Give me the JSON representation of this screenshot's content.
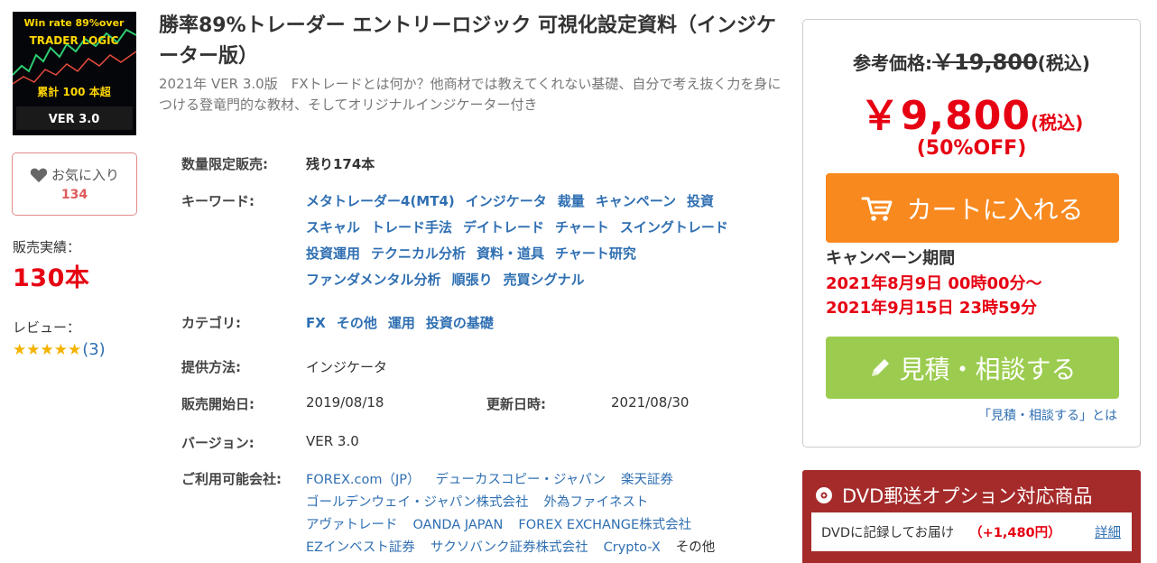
{
  "product": {
    "thumbnail_alt": "Win rate 89% over TRADER LOGIC",
    "thumb_text_1": "Win rate 89%over",
    "thumb_text_2": "TRADER LOGIC",
    "thumb_text_3": "累計 100 本超",
    "thumb_text_4": "VER 3.0",
    "title": "勝率89%トレーダー エントリーロジック 可視化設定資料（インジケーター版）",
    "description": "2021年 VER 3.0版　FXトレードとは何か？他商材では教えてくれない基礎、自分で考え抜く力を身につける登竜門的な教材、そしてオリジナルインジケーター付き"
  },
  "favorite": {
    "label": "お気に入り",
    "count": "134"
  },
  "sales": {
    "label": "販売実績：",
    "value": "130本"
  },
  "review": {
    "label": "レビュー：",
    "stars": "★★★★★",
    "count": "(3)"
  },
  "specs": {
    "limited_label": "数量限定販売:",
    "limited_value": "残り174本",
    "keyword_label": "キーワード:",
    "keywords": [
      [
        "メタトレーダー4(MT4)",
        "インジケータ",
        "裁量",
        "キャンペーン",
        "投資"
      ],
      [
        "スキャル",
        "トレード手法",
        "デイトレード",
        "チャート",
        "スイングトレード"
      ],
      [
        "投資運用",
        "テクニカル分析",
        "資料・道具",
        "チャート研究"
      ],
      [
        "ファンダメンタル分析",
        "順張り",
        "売買シグナル"
      ]
    ],
    "category_label": "カテゴリ:",
    "categories": [
      "FX",
      "その他",
      "運用",
      "投資の基礎"
    ],
    "method_label": "提供方法:",
    "method_value": "インジケータ",
    "start_label": "販売開始日:",
    "start_value": "2019/08/18",
    "updated_label": "更新日時:",
    "updated_value": "2021/08/30",
    "version_label": "バージョン:",
    "version_value": "VER 3.0",
    "companies_label": "ご利用可能会社:",
    "companies": [
      [
        "FOREX.com（JP）",
        "デューカスコピー・ジャパン",
        "楽天証券"
      ],
      [
        "ゴールデンウェイ・ジャパン株式会社",
        "外為ファイネスト"
      ],
      [
        "アヴァトレード",
        "OANDA JAPAN",
        "FOREX EXCHANGE株式会社"
      ],
      [
        "EZインベスト証券",
        "サクソバンク証券株式会社",
        "Crypto-X"
      ]
    ],
    "companies_other": "その他"
  },
  "pricing": {
    "ref_label": "参考価格:",
    "ref_price": "￥19,800",
    "ref_tax": "(税込)",
    "sale_price": "￥9,800",
    "sale_tax": "(税込)",
    "discount": "(50%OFF)",
    "cart_label": "カートに入れる",
    "campaign_title": "キャンペーン期間",
    "campaign_start": "2021年8月9日 00時00分～",
    "campaign_end": "2021年9月15日 23時59分",
    "quote_label": "見積・相談する",
    "quote_help": "「見積・相談する」とは"
  },
  "dvd": {
    "title": "DVD郵送オプション対応商品",
    "text": "DVDに記録してお届け",
    "fee": "（+1,480円）",
    "detail": "詳細"
  },
  "colors": {
    "accent_red": "#e60012",
    "link_blue": "#2f6fb2",
    "cart_orange": "#f7891f",
    "quote_green": "#9ccc4f",
    "dvd_maroon": "#a52a2a",
    "star_gold": "#f5b301"
  }
}
